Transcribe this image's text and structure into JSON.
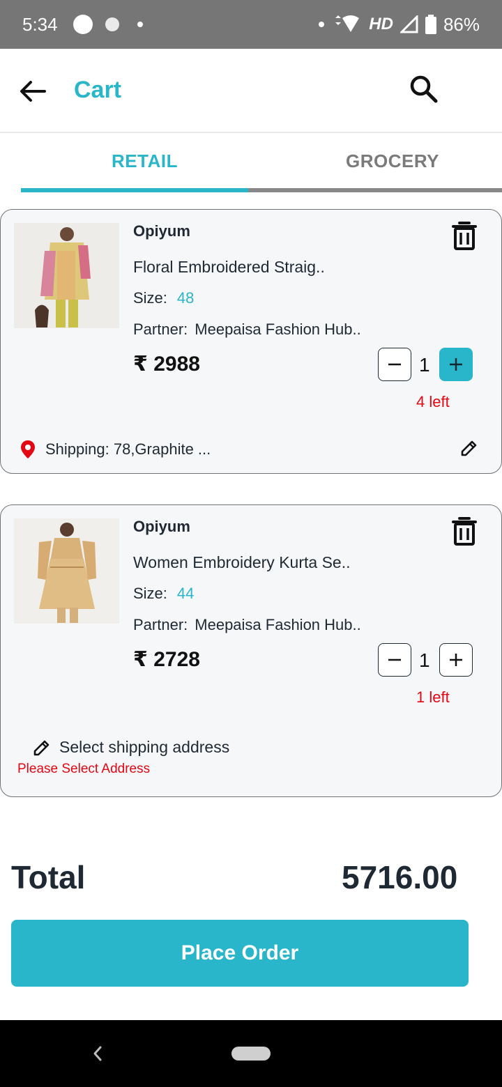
{
  "status_bar": {
    "time": "5:34",
    "network": "HD",
    "battery": "86%"
  },
  "header": {
    "title": "Cart"
  },
  "tabs": [
    {
      "label": "RETAIL",
      "active": true
    },
    {
      "label": "GROCERY",
      "active": false
    }
  ],
  "cart_items": [
    {
      "brand": "Opiyum",
      "name": "Floral Embroidered Straig..",
      "size_label": "Size:",
      "size": "48",
      "partner_label": "Partner:",
      "partner": "Meepaisa Fashion Hub..",
      "price": "₹ 2988",
      "quantity": "1",
      "stock": "4 left",
      "shipping": "Shipping: 78,Graphite ..."
    },
    {
      "brand": "Opiyum",
      "name": "Women Embroidery Kurta Se..",
      "size_label": "Size:",
      "size": "44",
      "partner_label": "Partner:",
      "partner": "Meepaisa Fashion Hub..",
      "price": "₹ 2728",
      "quantity": "1",
      "stock": "1 left",
      "select_shipping": "Select shipping address",
      "address_error": "Please Select Address"
    }
  ],
  "summary": {
    "total_label": "Total",
    "total_value": "5716.00",
    "place_order_label": "Place Order"
  },
  "colors": {
    "accent": "#29b6cb",
    "error": "#e30613",
    "text": "#1f2933"
  },
  "icons": [
    "back-arrow-icon",
    "search-icon",
    "trash-icon",
    "location-pin-icon",
    "edit-pencil-icon"
  ]
}
